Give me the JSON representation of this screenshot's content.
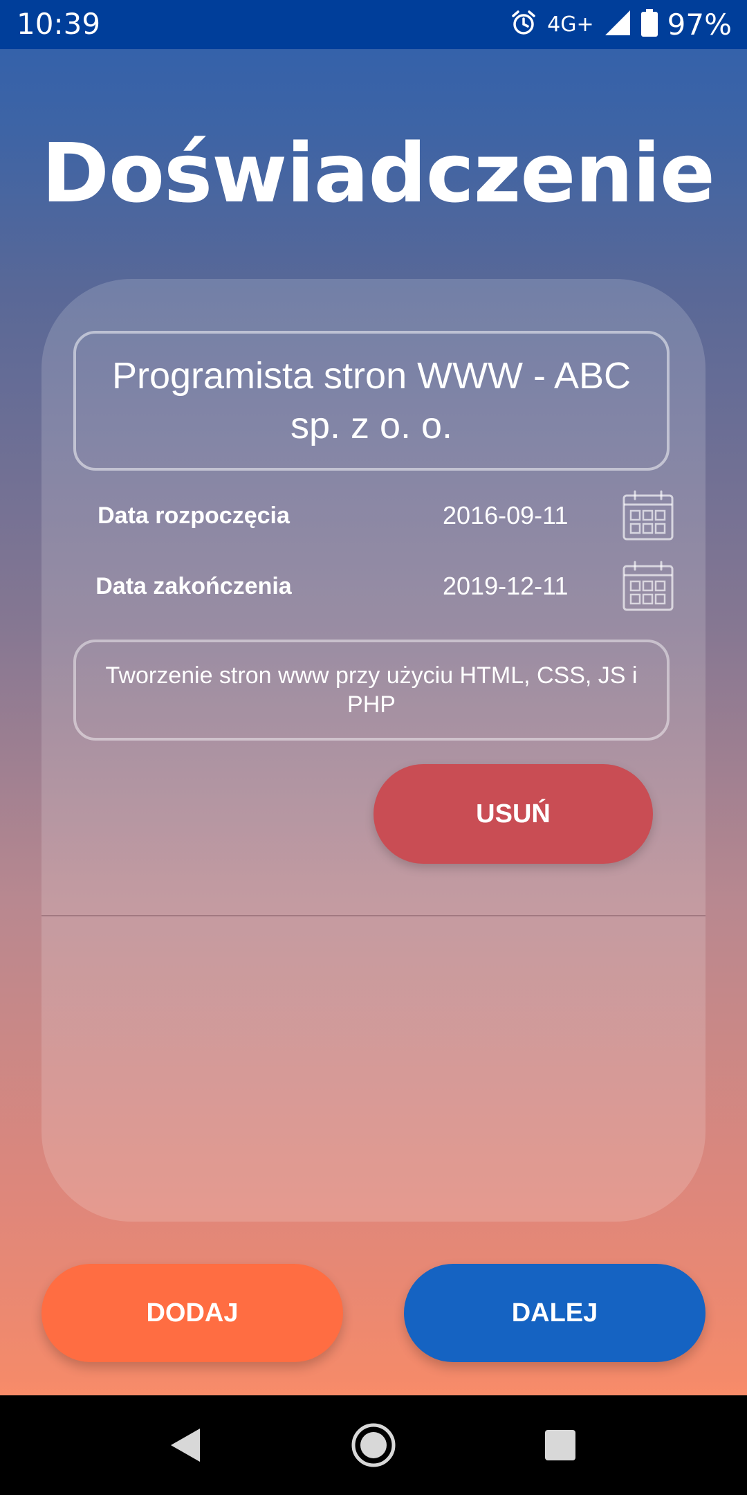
{
  "status_bar": {
    "time": "10:39",
    "network": "4G+",
    "battery": "97%",
    "icons": [
      "alarm-icon",
      "signal-icon",
      "battery-icon"
    ]
  },
  "page": {
    "title": "Doświadczenie"
  },
  "experience": {
    "job_title": "Programista stron WWW - ABC sp. z o. o.",
    "start_label": "Data rozpoczęcia",
    "start_date": "2016-09-11",
    "end_label": "Data zakończenia",
    "end_date": "2019-12-11",
    "description": "Tworzenie stron www przy użyciu HTML, CSS, JS i PHP",
    "delete_label": "USUŃ"
  },
  "actions": {
    "add_label": "DODAJ",
    "next_label": "DALEJ"
  },
  "nav": {
    "icons": [
      "back-icon",
      "home-icon",
      "recents-icon"
    ]
  },
  "colors": {
    "status_bar": "#003e9a",
    "delete_button": "#c94d54",
    "add_button": "#ff6d42",
    "next_button": "#1563c2",
    "gradient_top": "#2f60ad",
    "gradient_bottom": "#f98c69"
  }
}
